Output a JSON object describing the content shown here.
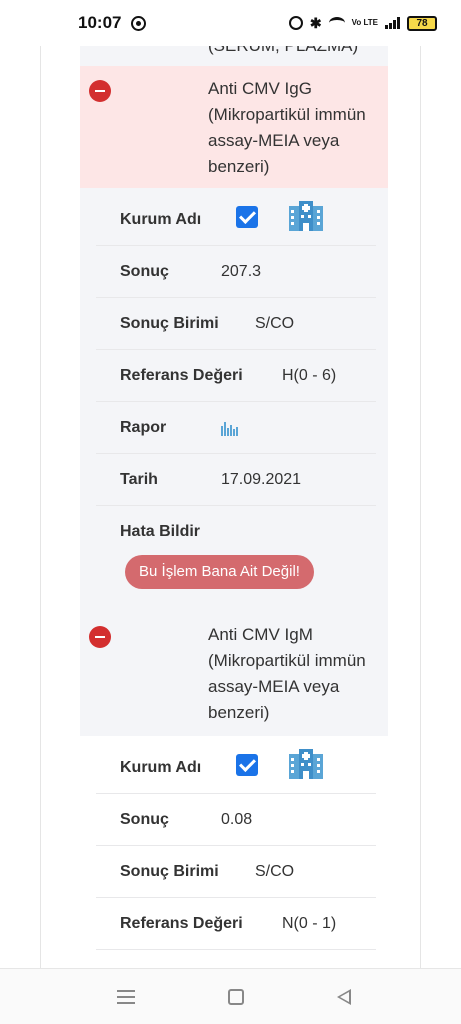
{
  "status_bar": {
    "time": "10:07",
    "battery": "78",
    "network": "Vo LTE"
  },
  "partial_top_text": "(SERUM, PLAZMA)",
  "results": [
    {
      "test_name": "Anti CMV IgG (Mikropartikül immün assay-MEIA veya benzeri)",
      "header_bg": "#fde6e6",
      "labels": {
        "kurum": "Kurum Adı",
        "sonuc": "Sonuç",
        "birim": "Sonuç Birimi",
        "referans": "Referans Değeri",
        "rapor": "Rapor",
        "tarih": "Tarih",
        "hata": "Hata Bildir"
      },
      "sonuc": "207.3",
      "birim": "S/CO",
      "referans": "H(0 - 6)",
      "tarih": "17.09.2021",
      "error_button": "Bu İşlem Bana Ait Değil!"
    },
    {
      "test_name": "Anti CMV IgM (Mikropartikül immün assay-MEIA veya benzeri)",
      "header_bg": "#f4f5f8",
      "labels": {
        "kurum": "Kurum Adı",
        "sonuc": "Sonuç",
        "birim": "Sonuç Birimi",
        "referans": "Referans Değeri"
      },
      "sonuc": "0.08",
      "birim": "S/CO",
      "referans": "N(0 - 1)"
    }
  ],
  "colors": {
    "accent_blue": "#1a73e8",
    "danger": "#d32f2f",
    "error_button": "#d46a6e",
    "panel": "#f4f5f8"
  },
  "icons": [
    "whatsapp-icon",
    "alarm-icon",
    "bluetooth-icon",
    "wifi-icon",
    "signal-icon",
    "battery-icon",
    "minus-circle-icon",
    "checkbox-icon",
    "hospital-icon",
    "bar-chart-icon",
    "menu-icon",
    "home-icon",
    "back-icon"
  ]
}
